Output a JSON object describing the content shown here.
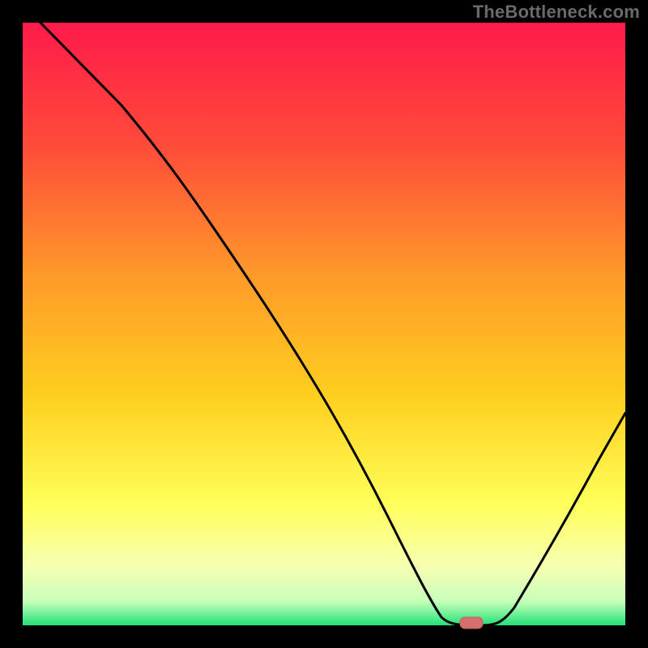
{
  "watermark": "TheBottleneck.com",
  "chart_data": {
    "type": "line",
    "title": "",
    "xlabel": "",
    "ylabel": "",
    "xlim": [
      0,
      100
    ],
    "ylim": [
      0,
      100
    ],
    "grid": false,
    "legend": false,
    "background_gradient": {
      "top_color": "#ff1a4a",
      "mid_color_1": "#ff7a2e",
      "mid_color_2": "#ffd21e",
      "lower_color": "#ffff7a",
      "bottom_color": "#28e67a"
    },
    "series": [
      {
        "name": "bottleneck-curve",
        "x": [
          3,
          12,
          23,
          35,
          47,
          58,
          64,
          68,
          72,
          76,
          82,
          88,
          94,
          100
        ],
        "y": [
          100,
          88,
          74,
          58,
          41,
          24,
          12,
          4,
          0,
          0,
          6,
          14,
          24,
          34
        ]
      }
    ],
    "marker": {
      "name": "optimal-point",
      "x": 74,
      "y": 0,
      "color": "#d4706e",
      "shape": "rounded-rect"
    }
  }
}
